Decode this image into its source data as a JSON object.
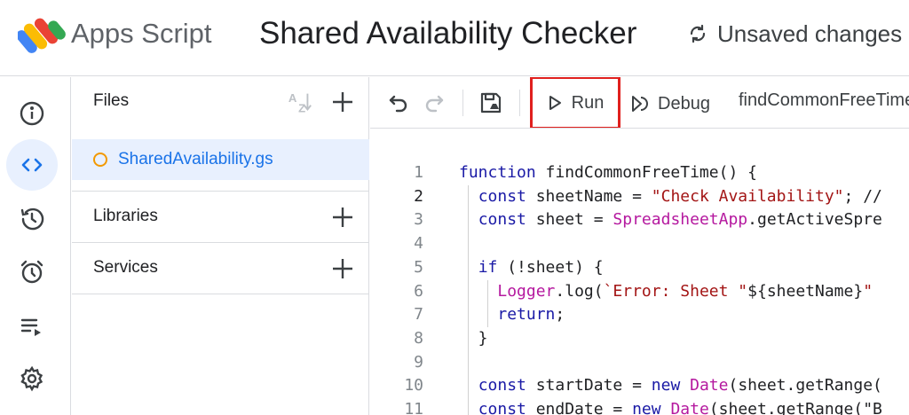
{
  "header": {
    "brand": "Apps Script",
    "project_title": "Shared Availability Checker",
    "status": "Unsaved changes"
  },
  "files_panel": {
    "title": "Files",
    "sort_label": "AZ",
    "files": [
      {
        "name": "SharedAvailability.gs",
        "status_color": "#f29900"
      }
    ],
    "libraries_label": "Libraries",
    "services_label": "Services"
  },
  "toolbar": {
    "run_label": "Run",
    "debug_label": "Debug",
    "function_name": "findCommonFreeTime"
  },
  "editor": {
    "line_numbers": [
      "1",
      "2",
      "3",
      "4",
      "5",
      "6",
      "7",
      "8",
      "9",
      "10",
      "11"
    ],
    "current_line": 2,
    "lines": [
      [
        {
          "t": "kw",
          "v": "function"
        },
        {
          "t": "",
          "v": " findCommonFreeTime() {"
        }
      ],
      [
        {
          "t": "",
          "v": "  "
        },
        {
          "t": "kw",
          "v": "const"
        },
        {
          "t": "",
          "v": " sheetName = "
        },
        {
          "t": "str",
          "v": "\"Check Availability\""
        },
        {
          "t": "",
          "v": "; //"
        }
      ],
      [
        {
          "t": "",
          "v": "  "
        },
        {
          "t": "kw",
          "v": "const"
        },
        {
          "t": "",
          "v": " sheet = "
        },
        {
          "t": "cls",
          "v": "SpreadsheetApp"
        },
        {
          "t": "",
          "v": ".getActiveSpre"
        }
      ],
      [
        {
          "t": "",
          "v": ""
        }
      ],
      [
        {
          "t": "",
          "v": "  "
        },
        {
          "t": "kw",
          "v": "if"
        },
        {
          "t": "",
          "v": " (!sheet) {"
        }
      ],
      [
        {
          "t": "",
          "v": "    "
        },
        {
          "t": "cls",
          "v": "Logger"
        },
        {
          "t": "",
          "v": ".log("
        },
        {
          "t": "str",
          "v": "`Error: Sheet \""
        },
        {
          "t": "",
          "v": "${sheetName}"
        },
        {
          "t": "str",
          "v": "\""
        }
      ],
      [
        {
          "t": "",
          "v": "    "
        },
        {
          "t": "kw",
          "v": "return"
        },
        {
          "t": "",
          "v": ";"
        }
      ],
      [
        {
          "t": "",
          "v": "  }"
        }
      ],
      [
        {
          "t": "",
          "v": ""
        }
      ],
      [
        {
          "t": "",
          "v": "  "
        },
        {
          "t": "kw",
          "v": "const"
        },
        {
          "t": "",
          "v": " startDate = "
        },
        {
          "t": "kw",
          "v": "new"
        },
        {
          "t": "",
          "v": " "
        },
        {
          "t": "cls",
          "v": "Date"
        },
        {
          "t": "",
          "v": "(sheet.getRange("
        }
      ],
      [
        {
          "t": "",
          "v": "  "
        },
        {
          "t": "kw",
          "v": "const"
        },
        {
          "t": "",
          "v": " endDate = "
        },
        {
          "t": "kw",
          "v": "new"
        },
        {
          "t": "",
          "v": " "
        },
        {
          "t": "cls",
          "v": "Date"
        },
        {
          "t": "",
          "v": "(sheet.getRange(\"B"
        }
      ]
    ]
  },
  "colors": {
    "accent": "#1a73e8",
    "run_highlight": "#e0201e",
    "selected_bg": "#e8f0fe"
  }
}
